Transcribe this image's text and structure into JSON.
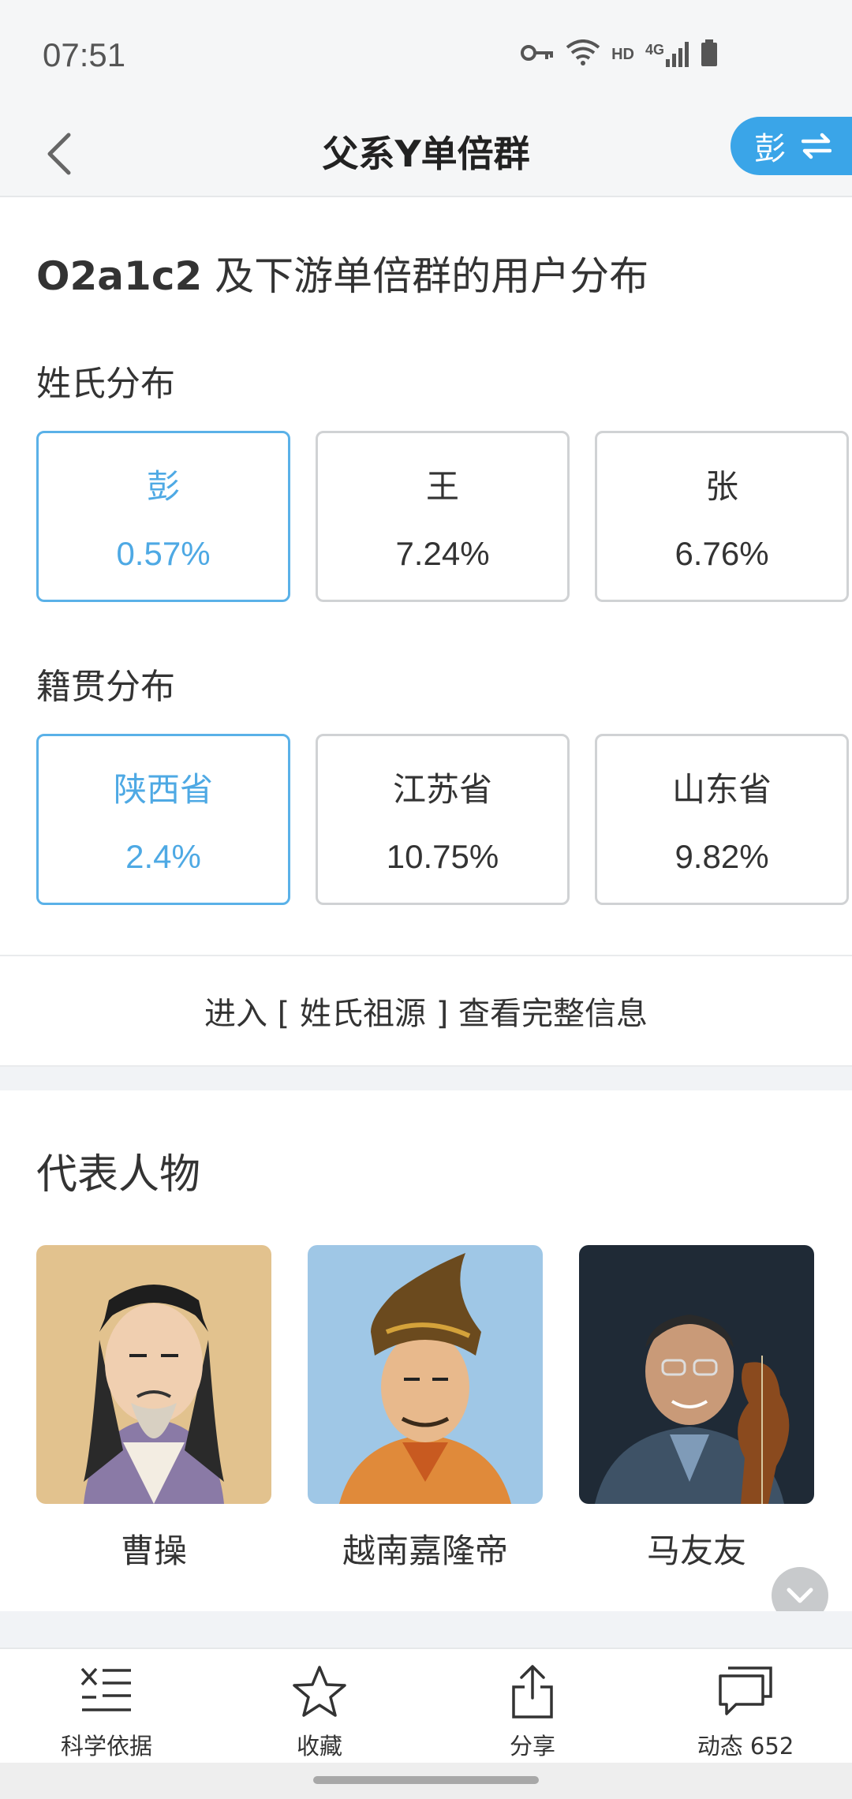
{
  "status_bar": {
    "time": "07:51",
    "hd": "HD",
    "network": "4G"
  },
  "nav": {
    "title": "父系Y单倍群",
    "switch_surname": "彭"
  },
  "distribution": {
    "haplogroup": "O2a1c2",
    "title_suffix": " 及下游单倍群的用户分布",
    "surname_label": "姓氏分布",
    "surnames": [
      {
        "name": "彭",
        "pct": "0.57%"
      },
      {
        "name": "王",
        "pct": "7.24%"
      },
      {
        "name": "张",
        "pct": "6.76%"
      }
    ],
    "origin_label": "籍贯分布",
    "origins": [
      {
        "name": "陕西省",
        "pct": "2.4%"
      },
      {
        "name": "江苏省",
        "pct": "10.75%"
      },
      {
        "name": "山东省",
        "pct": "9.82%"
      }
    ],
    "enter_link": "进入 [ 姓氏祖源 ] 查看完整信息"
  },
  "people": {
    "title": "代表人物",
    "items": [
      {
        "name": "曹操"
      },
      {
        "name": "越南嘉隆帝"
      },
      {
        "name": "马友友"
      }
    ]
  },
  "bottom_tabs": [
    {
      "label": "科学依据",
      "icon": "science-basis-icon"
    },
    {
      "label": "收藏",
      "icon": "star-icon"
    },
    {
      "label": "分享",
      "icon": "share-icon"
    },
    {
      "label": "动态 652",
      "icon": "comments-icon"
    }
  ],
  "colors": {
    "accent": "#3aa5e8",
    "active_text": "#4ea9e4"
  }
}
